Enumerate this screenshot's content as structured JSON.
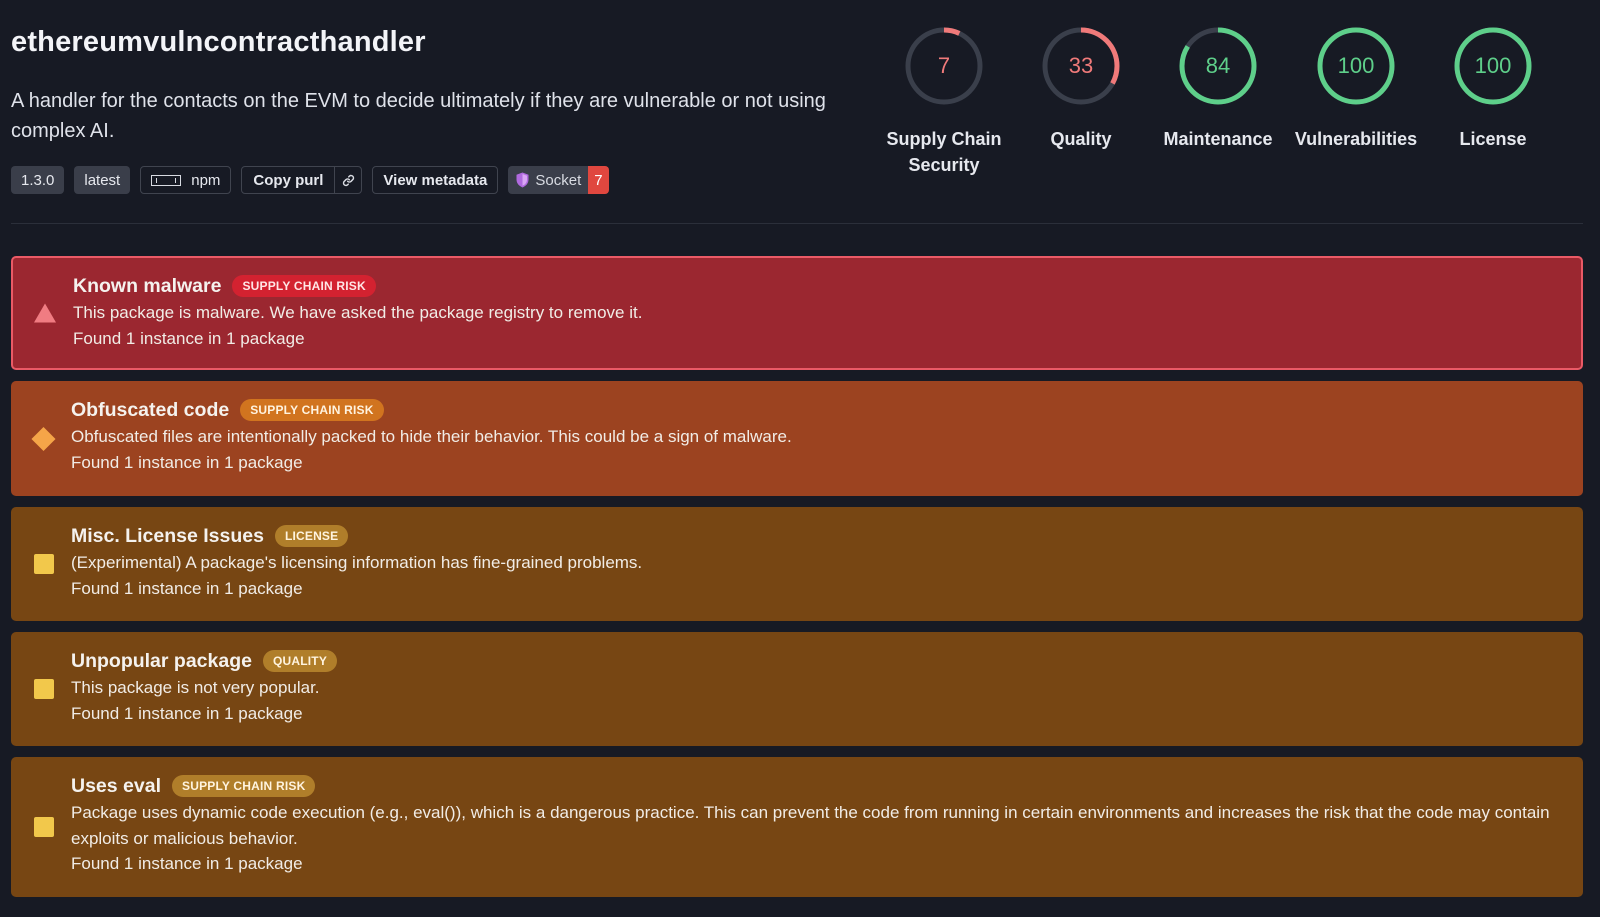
{
  "package": {
    "name": "ethereumvulncontracthandler",
    "description": "A handler for the contacts on the EVM to decide ultimately if they are vulnerable or not using complex AI.",
    "version": "1.3.0",
    "tag": "latest",
    "registry": "npm",
    "copy_purl_label": "Copy purl",
    "view_metadata_label": "View metadata",
    "socket_label": "Socket",
    "socket_count": "7"
  },
  "scores": [
    {
      "label_line1": "Supply Chain",
      "label_line2": "Security",
      "value": "7",
      "percent": 7,
      "color": "#f07a7a"
    },
    {
      "label_line1": "Quality",
      "label_line2": "",
      "value": "33",
      "percent": 33,
      "color": "#f07a7a"
    },
    {
      "label_line1": "Maintenance",
      "label_line2": "",
      "value": "84",
      "percent": 84,
      "color": "#5ecf8a"
    },
    {
      "label_line1": "Vulnerabilities",
      "label_line2": "",
      "value": "100",
      "percent": 100,
      "color": "#5ecf8a"
    },
    {
      "label_line1": "License",
      "label_line2": "",
      "value": "100",
      "percent": 100,
      "color": "#5ecf8a"
    }
  ],
  "alerts": [
    {
      "title": "Known malware",
      "badge": "SUPPLY CHAIN RISK",
      "description": "This package is malware. We have asked the package registry to remove it.",
      "found": "Found 1 instance in 1 package",
      "icon": "warning-triangle-icon"
    },
    {
      "title": "Obfuscated code",
      "badge": "SUPPLY CHAIN RISK",
      "description": "Obfuscated files are intentionally packed to hide their behavior. This could be a sign of malware.",
      "found": "Found 1 instance in 1 package",
      "icon": "diamond-icon"
    },
    {
      "title": "Misc. License Issues",
      "badge": "LICENSE",
      "description": "(Experimental) A package's licensing information has fine-grained problems.",
      "found": "Found 1 instance in 1 package",
      "icon": "square-icon"
    },
    {
      "title": "Unpopular package",
      "badge": "QUALITY",
      "description": "This package is not very popular.",
      "found": "Found 1 instance in 1 package",
      "icon": "square-icon"
    },
    {
      "title": "Uses eval",
      "badge": "SUPPLY CHAIN RISK",
      "description": "Package uses dynamic code execution (e.g., eval()), which is a dangerous practice. This can prevent the code from running in certain environments and increases the risk that the code may contain exploits or malicious behavior.",
      "found": "Found 1 instance in 1 package",
      "icon": "square-icon"
    }
  ]
}
